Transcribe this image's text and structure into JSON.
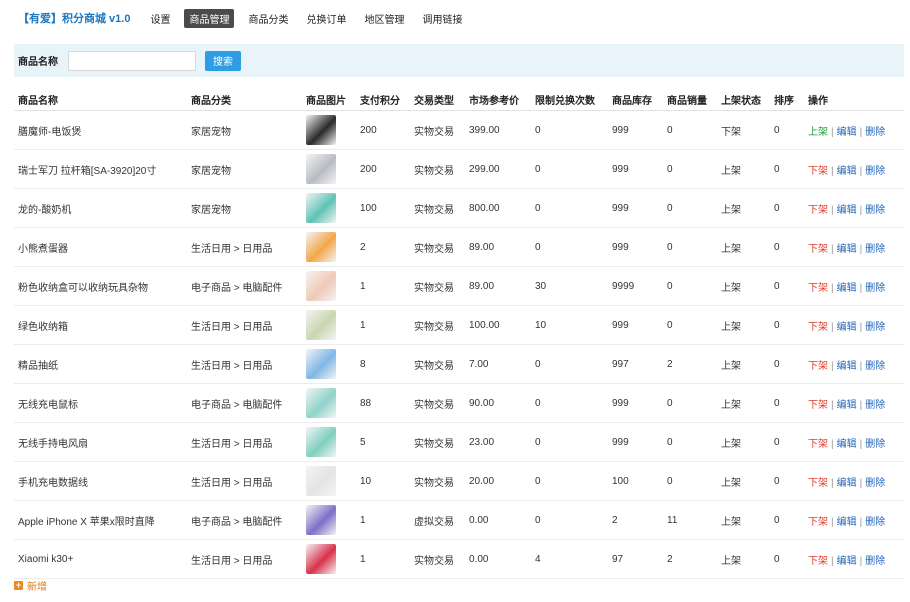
{
  "header": {
    "brand": "【有爱】积分商城 v1.0",
    "nav": [
      {
        "label": "设置",
        "active": false
      },
      {
        "label": "商品管理",
        "active": true
      },
      {
        "label": "商品分类",
        "active": false
      },
      {
        "label": "兑换订单",
        "active": false
      },
      {
        "label": "地区管理",
        "active": false
      },
      {
        "label": "调用链接",
        "active": false
      }
    ]
  },
  "search": {
    "label": "商品名称",
    "value": "",
    "placeholder": "",
    "button": "搜索"
  },
  "table": {
    "headers": [
      "商品名称",
      "商品分类",
      "商品图片",
      "支付积分",
      "交易类型",
      "市场参考价",
      "限制兑换次数",
      "商品库存",
      "商品销量",
      "上架状态",
      "排序",
      "操作"
    ],
    "actions": {
      "edit": "编辑",
      "delete": "删除",
      "sep": "|"
    },
    "rows": [
      {
        "name": "膳魔师-电饭煲",
        "category": "家居宠物",
        "image": "rice-cooker-icon",
        "points": "200",
        "type": "实物交易",
        "price": "399.00",
        "limit": "0",
        "stock": "999",
        "sales": "0",
        "status": "下架",
        "status_on": false,
        "sort": "0",
        "toggle": "上架",
        "color": "#2b2b2b"
      },
      {
        "name": "瑞士军刀 拉杆箱[SA-3920]20寸",
        "category": "家居宠物",
        "image": "suitcase-icon",
        "points": "200",
        "type": "实物交易",
        "price": "299.00",
        "limit": "0",
        "stock": "999",
        "sales": "0",
        "status": "上架",
        "status_on": true,
        "sort": "0",
        "toggle": "下架",
        "color": "#b8bcc2"
      },
      {
        "name": "龙的-酸奶机",
        "category": "家居宠物",
        "image": "yogurt-maker-icon",
        "points": "100",
        "type": "实物交易",
        "price": "800.00",
        "limit": "0",
        "stock": "999",
        "sales": "0",
        "status": "上架",
        "status_on": true,
        "sort": "0",
        "toggle": "下架",
        "color": "#5fc3b5"
      },
      {
        "name": "小熊煮蛋器",
        "category": "生活日用 > 日用品",
        "image": "egg-cooker-icon",
        "points": "2",
        "type": "实物交易",
        "price": "89.00",
        "limit": "0",
        "stock": "999",
        "sales": "0",
        "status": "上架",
        "status_on": true,
        "sort": "0",
        "toggle": "下架",
        "color": "#f3a64a"
      },
      {
        "name": "粉色收纳盒可以收纳玩具杂物",
        "category": "电子商品 > 电脑配件",
        "image": "storage-box-icon",
        "points": "1",
        "type": "实物交易",
        "price": "89.00",
        "limit": "30",
        "stock": "9999",
        "sales": "0",
        "status": "上架",
        "status_on": true,
        "sort": "0",
        "toggle": "下架",
        "color": "#f0c9b6"
      },
      {
        "name": "绿色收纳箱",
        "category": "生活日用 > 日用品",
        "image": "storage-bin-icon",
        "points": "1",
        "type": "实物交易",
        "price": "100.00",
        "limit": "10",
        "stock": "999",
        "sales": "0",
        "status": "上架",
        "status_on": true,
        "sort": "0",
        "toggle": "下架",
        "color": "#c9d6b0"
      },
      {
        "name": "精品抽纸",
        "category": "生活日用 > 日用品",
        "image": "tissue-box-icon",
        "points": "8",
        "type": "实物交易",
        "price": "7.00",
        "limit": "0",
        "stock": "997",
        "sales": "2",
        "status": "上架",
        "status_on": true,
        "sort": "0",
        "toggle": "下架",
        "color": "#7fb6e6"
      },
      {
        "name": "无线充电鼠标",
        "category": "电子商品 > 电脑配件",
        "image": "mouse-icon",
        "points": "88",
        "type": "实物交易",
        "price": "90.00",
        "limit": "0",
        "stock": "999",
        "sales": "0",
        "status": "上架",
        "status_on": true,
        "sort": "0",
        "toggle": "下架",
        "color": "#8fd3c9"
      },
      {
        "name": "无线手持电风扇",
        "category": "生活日用 > 日用品",
        "image": "fan-icon",
        "points": "5",
        "type": "实物交易",
        "price": "23.00",
        "limit": "0",
        "stock": "999",
        "sales": "0",
        "status": "上架",
        "status_on": true,
        "sort": "0",
        "toggle": "下架",
        "color": "#7fcfbf"
      },
      {
        "name": "手机充电数据线",
        "category": "生活日用 > 日用品",
        "image": "cable-icon",
        "points": "10",
        "type": "实物交易",
        "price": "20.00",
        "limit": "0",
        "stock": "100",
        "sales": "0",
        "status": "上架",
        "status_on": true,
        "sort": "0",
        "toggle": "下架",
        "color": "#e4e4e4"
      },
      {
        "name": "Apple iPhone X 苹果x限时直降",
        "category": "电子商品 > 电脑配件",
        "image": "phone-icon",
        "points": "1",
        "type": "虚拟交易",
        "price": "0.00",
        "limit": "0",
        "stock": "2",
        "sales": "11",
        "status": "上架",
        "status_on": true,
        "sort": "0",
        "toggle": "下架",
        "color": "#7d6fc6"
      },
      {
        "name": "Xiaomi k30+",
        "category": "生活日用 > 日用品",
        "image": "phone-icon",
        "points": "1",
        "type": "实物交易",
        "price": "0.00",
        "limit": "4",
        "stock": "97",
        "sales": "2",
        "status": "上架",
        "status_on": true,
        "sort": "0",
        "toggle": "下架",
        "color": "#d9324a"
      }
    ]
  },
  "footer": {
    "add_label": "新增",
    "add_icon": "plus-icon"
  },
  "colors": {
    "accent": "#2e9de4",
    "on": "#1e9a2e",
    "off": "#e03b2b",
    "link": "#2266bb"
  }
}
